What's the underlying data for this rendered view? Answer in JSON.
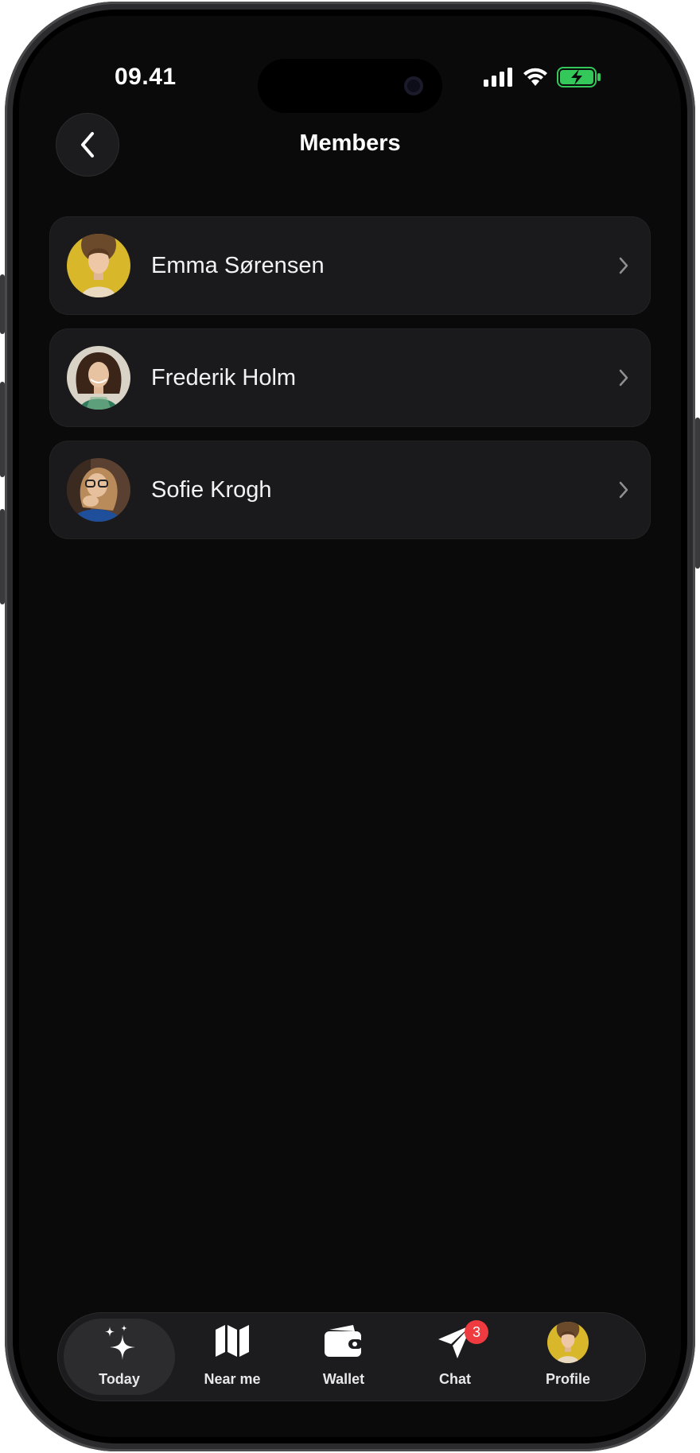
{
  "status_bar": {
    "time": "09.41"
  },
  "header": {
    "title": "Members"
  },
  "members": [
    {
      "name": "Emma Sørensen"
    },
    {
      "name": "Frederik Holm"
    },
    {
      "name": "Sofie Krogh"
    }
  ],
  "tabbar": {
    "tabs": [
      {
        "label": "Today",
        "icon": "sparkles-icon",
        "active": true
      },
      {
        "label": "Near me",
        "icon": "map-icon"
      },
      {
        "label": "Wallet",
        "icon": "wallet-icon"
      },
      {
        "label": "Chat",
        "icon": "paper-plane-icon",
        "badge": "3"
      },
      {
        "label": "Profile",
        "icon": "avatar"
      }
    ]
  },
  "colors": {
    "background": "#0a0a0b",
    "card": "#1a1a1c",
    "badge": "#ef3b3f",
    "battery": "#34c759"
  }
}
